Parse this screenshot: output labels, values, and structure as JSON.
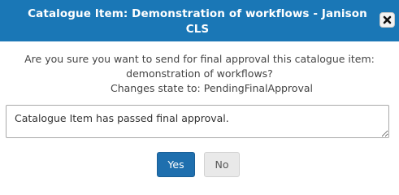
{
  "dialog": {
    "title": "Catalogue Item: Demonstration of workflows - Janison CLS",
    "close_icon": "close-icon",
    "colors": {
      "titlebar": "#1a77b6",
      "primary_button": "#1f6fae",
      "secondary_button": "#e9e9e9"
    }
  },
  "body": {
    "question": "Are you sure you want to send for final approval this catalogue item: demonstration of workflows?",
    "state_label": "Changes state to:",
    "state_value": "PendingFinalApproval",
    "comment_value": "Catalogue Item has passed final approval."
  },
  "buttons": {
    "yes_label": "Yes",
    "no_label": "No"
  }
}
